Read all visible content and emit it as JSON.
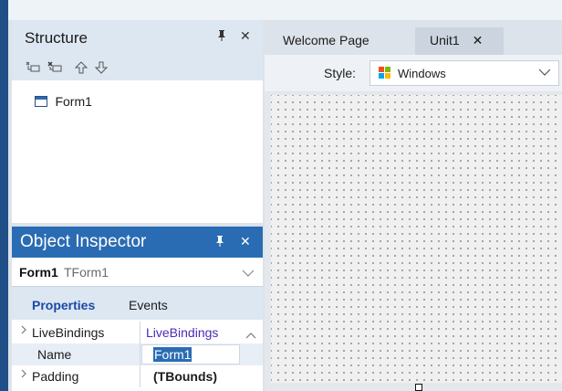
{
  "structure": {
    "title": "Structure",
    "pin_glyph": "📌",
    "close_glyph": "✕",
    "toolbar": [
      "expand-all-icon",
      "collapse-all-icon",
      "arrow-up-icon",
      "arrow-down-icon"
    ],
    "tree": {
      "label": "Form1",
      "icon": "form-icon"
    }
  },
  "object_inspector": {
    "title": "Object Inspector",
    "pin_glyph": "📌",
    "close_glyph": "✕",
    "selector": {
      "name": "Form1",
      "type": "TForm1"
    },
    "tabs": [
      {
        "label": "Properties",
        "active": true
      },
      {
        "label": "Events",
        "active": false
      }
    ],
    "rows": [
      {
        "name": "LiveBindings",
        "value": "LiveBindings",
        "expandable": true
      },
      {
        "name": "Name",
        "value": "Form1",
        "expandable": false,
        "selected": true
      },
      {
        "name": "Padding",
        "value": "(TBounds)",
        "expandable": true
      }
    ]
  },
  "editor_tabs": [
    {
      "label": "Welcome Page",
      "active": false
    },
    {
      "label": "Unit1",
      "active": true,
      "close_glyph": "✕"
    }
  ],
  "style_bar": {
    "label": "Style:",
    "value": "Windows",
    "icon": "windows-logo-icon"
  },
  "colors": {
    "accent": "#2a6cb3",
    "link": "#1a4aa5",
    "selection": "#2a6cb3"
  }
}
